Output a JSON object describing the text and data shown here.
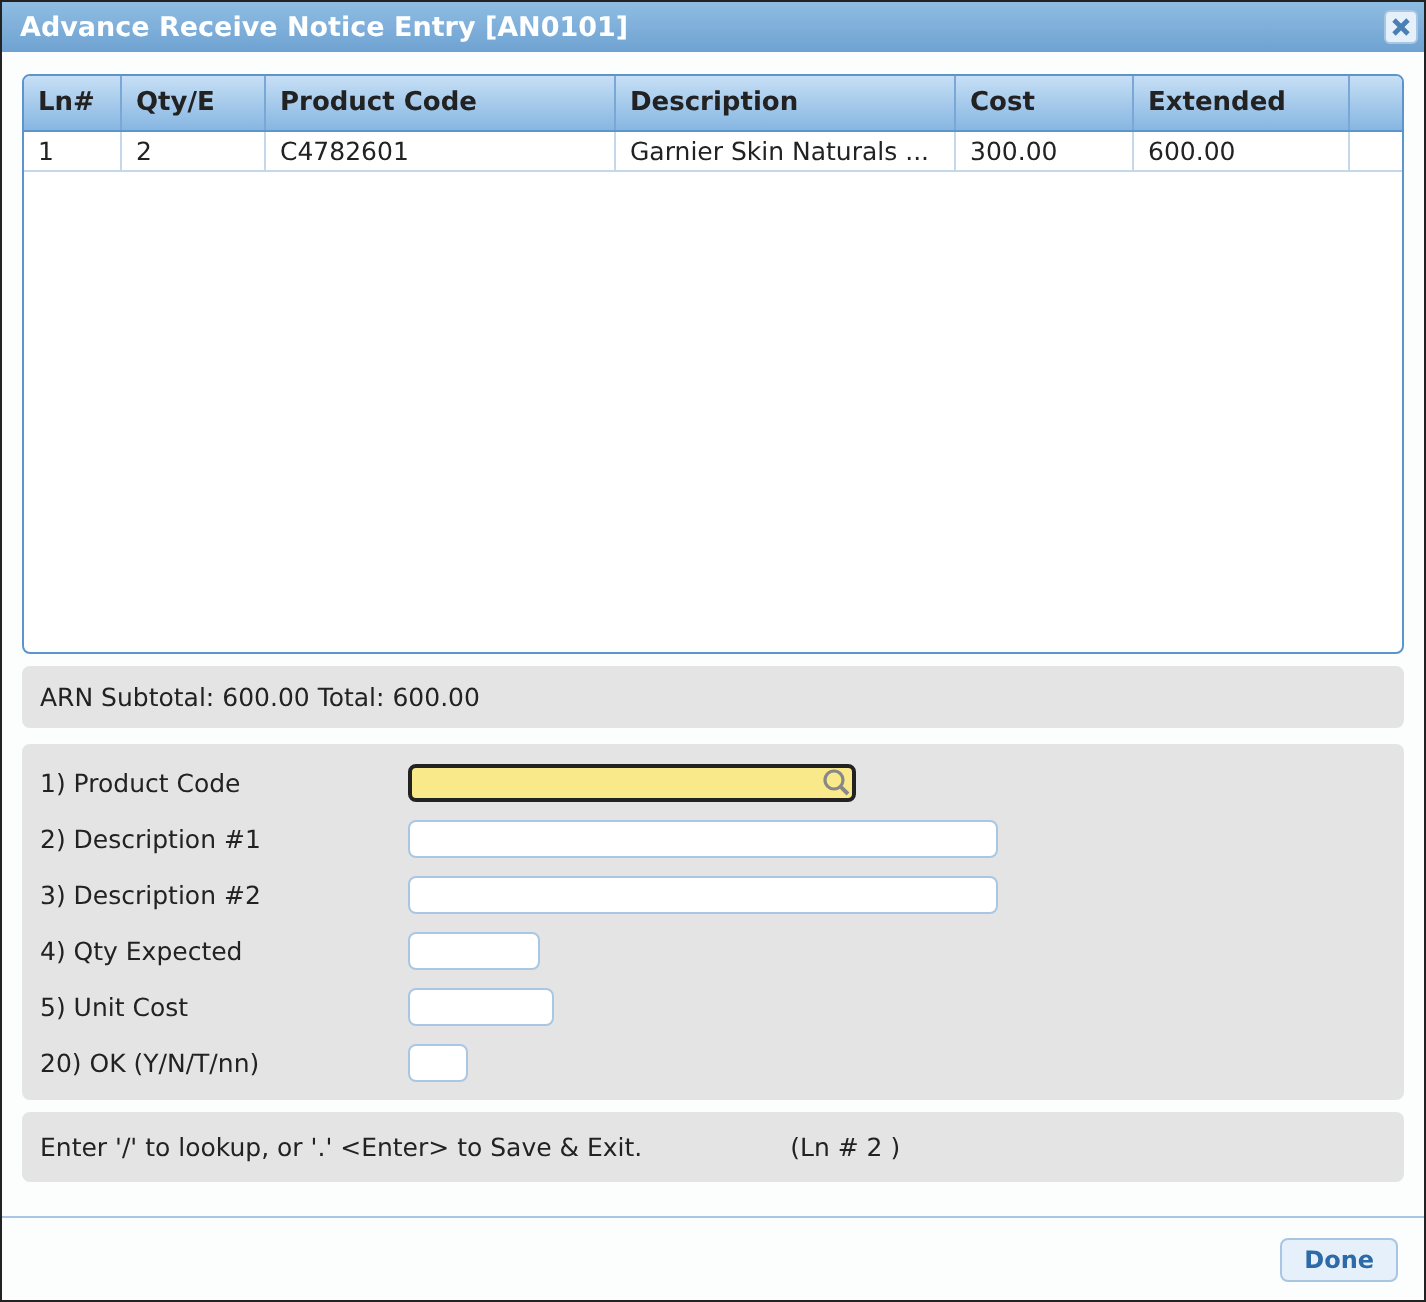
{
  "window": {
    "title": "Advance Receive Notice Entry [AN0101]"
  },
  "table": {
    "columns": [
      "Ln#",
      "Qty/E",
      "Product Code",
      "Description",
      "Cost",
      "Extended"
    ],
    "rows": [
      [
        "1",
        "2",
        "C4782601",
        "Garnier Skin Naturals ...",
        "300.00",
        "600.00"
      ]
    ]
  },
  "totals": "ARN Subtotal: 600.00 Total: 600.00",
  "form": [
    {
      "label": "1) Product Code",
      "focused": true,
      "lookup": true
    },
    {
      "label": "2) Description #1",
      "focused": false,
      "lookup": false
    },
    {
      "label": "3) Description #2",
      "focused": false,
      "lookup": false
    },
    {
      "label": "4) Qty Expected",
      "focused": false,
      "lookup": false
    },
    {
      "label": "5) Unit Cost",
      "focused": false,
      "lookup": false
    },
    {
      "label": "20) OK (Y/N/T/nn)",
      "focused": false,
      "lookup": false
    }
  ],
  "hint": {
    "message": "Enter '/' to lookup, or '.' <Enter> to Save & Exit.",
    "line": "(Ln # 2 )"
  },
  "buttons": [
    "Done"
  ]
}
